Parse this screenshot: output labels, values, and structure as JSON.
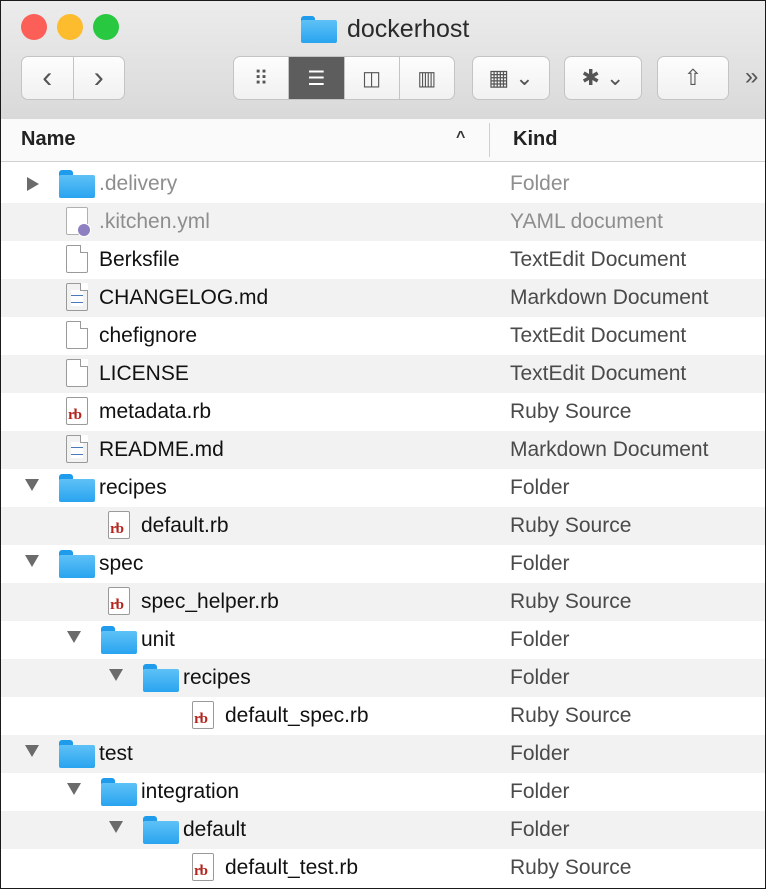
{
  "window": {
    "title": "dockerhost",
    "traffic_lights": [
      "#fc5f57",
      "#fdbc2e",
      "#28c840"
    ]
  },
  "toolbar": {
    "back_label": "‹",
    "forward_label": "›",
    "view_modes": [
      {
        "icon": "icon-view-icon",
        "glyph": "⠿",
        "active": false
      },
      {
        "icon": "list-view-icon",
        "glyph": "☰",
        "active": true
      },
      {
        "icon": "column-view-icon",
        "glyph": "◫",
        "active": false
      },
      {
        "icon": "cover-flow-icon",
        "glyph": "▥",
        "active": false
      }
    ],
    "arrange_label": "▦ ⌄",
    "action_label": "✱ ⌄",
    "share_label": "⇧",
    "overflow_label": "»"
  },
  "columns": {
    "name": "Name",
    "sort_indicator": "^",
    "kind": "Kind"
  },
  "rows": [
    {
      "name": ".delivery",
      "kind": "Folder",
      "type": "folder",
      "level": 0,
      "toggle": "closed",
      "dim": true
    },
    {
      "name": ".kitchen.yml",
      "kind": "YAML document",
      "type": "yml",
      "level": 0,
      "toggle": "none",
      "dim": true
    },
    {
      "name": "Berksfile",
      "kind": "TextEdit Document",
      "type": "doc",
      "level": 0,
      "toggle": "none",
      "dim": false
    },
    {
      "name": "CHANGELOG.md",
      "kind": "Markdown Document",
      "type": "md",
      "level": 0,
      "toggle": "none",
      "dim": false
    },
    {
      "name": "chefignore",
      "kind": "TextEdit Document",
      "type": "doc",
      "level": 0,
      "toggle": "none",
      "dim": false
    },
    {
      "name": "LICENSE",
      "kind": "TextEdit Document",
      "type": "doc",
      "level": 0,
      "toggle": "none",
      "dim": false
    },
    {
      "name": "metadata.rb",
      "kind": "Ruby Source",
      "type": "rb",
      "level": 0,
      "toggle": "none",
      "dim": false
    },
    {
      "name": "README.md",
      "kind": "Markdown Document",
      "type": "md",
      "level": 0,
      "toggle": "none",
      "dim": false
    },
    {
      "name": "recipes",
      "kind": "Folder",
      "type": "folder",
      "level": 0,
      "toggle": "open",
      "dim": false
    },
    {
      "name": "default.rb",
      "kind": "Ruby Source",
      "type": "rb",
      "level": 1,
      "toggle": "none",
      "dim": false
    },
    {
      "name": "spec",
      "kind": "Folder",
      "type": "folder",
      "level": 0,
      "toggle": "open",
      "dim": false
    },
    {
      "name": "spec_helper.rb",
      "kind": "Ruby Source",
      "type": "rb",
      "level": 1,
      "toggle": "none",
      "dim": false
    },
    {
      "name": "unit",
      "kind": "Folder",
      "type": "folder",
      "level": 1,
      "toggle": "open",
      "dim": false
    },
    {
      "name": "recipes",
      "kind": "Folder",
      "type": "folder",
      "level": 2,
      "toggle": "open",
      "dim": false
    },
    {
      "name": "default_spec.rb",
      "kind": "Ruby Source",
      "type": "rb",
      "level": 3,
      "toggle": "none",
      "dim": false
    },
    {
      "name": "test",
      "kind": "Folder",
      "type": "folder",
      "level": 0,
      "toggle": "open",
      "dim": false
    },
    {
      "name": "integration",
      "kind": "Folder",
      "type": "folder",
      "level": 1,
      "toggle": "open",
      "dim": false
    },
    {
      "name": "default",
      "kind": "Folder",
      "type": "folder",
      "level": 2,
      "toggle": "open",
      "dim": false
    },
    {
      "name": "default_test.rb",
      "kind": "Ruby Source",
      "type": "rb",
      "level": 3,
      "toggle": "none",
      "dim": false
    }
  ]
}
